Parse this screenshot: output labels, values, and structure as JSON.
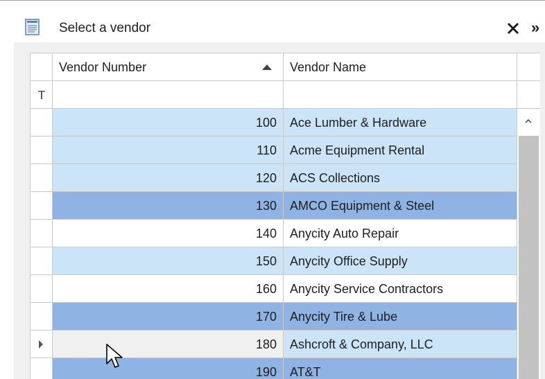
{
  "window": {
    "title": "Select a vendor",
    "close_glyph": "✕",
    "overflow_glyph": "»",
    "title_icon": "document-list-icon"
  },
  "grid": {
    "columns": [
      "Vendor Number",
      "Vendor Name"
    ],
    "sort": {
      "column": "Vendor Number",
      "direction": "ascending"
    },
    "filter_icon": "filter-icon",
    "current_row_vendor_number": "180",
    "rows": [
      {
        "number": "100",
        "name": "Ace Lumber & Hardware",
        "highlight": "light"
      },
      {
        "number": "110",
        "name": "Acme Equipment Rental",
        "highlight": "light"
      },
      {
        "number": "120",
        "name": "ACS Collections",
        "highlight": "light"
      },
      {
        "number": "130",
        "name": "AMCO Equipment & Steel",
        "highlight": "selected"
      },
      {
        "number": "140",
        "name": "Anycity Auto Repair",
        "highlight": "none"
      },
      {
        "number": "150",
        "name": "Anycity Office Supply",
        "highlight": "light"
      },
      {
        "number": "160",
        "name": "Anycity Service Contractors",
        "highlight": "none"
      },
      {
        "number": "170",
        "name": "Anycity Tire & Lube",
        "highlight": "selected"
      },
      {
        "number": "180",
        "name": "Ashcroft & Company, LLC",
        "highlight": "current"
      },
      {
        "number": "190",
        "name": "AT&T",
        "highlight": "selected"
      }
    ]
  },
  "colors": {
    "light": "#cce4f7",
    "selected": "#8fb4e3",
    "current_number_bg": "#f0f0f0",
    "none": "#ffffff"
  }
}
